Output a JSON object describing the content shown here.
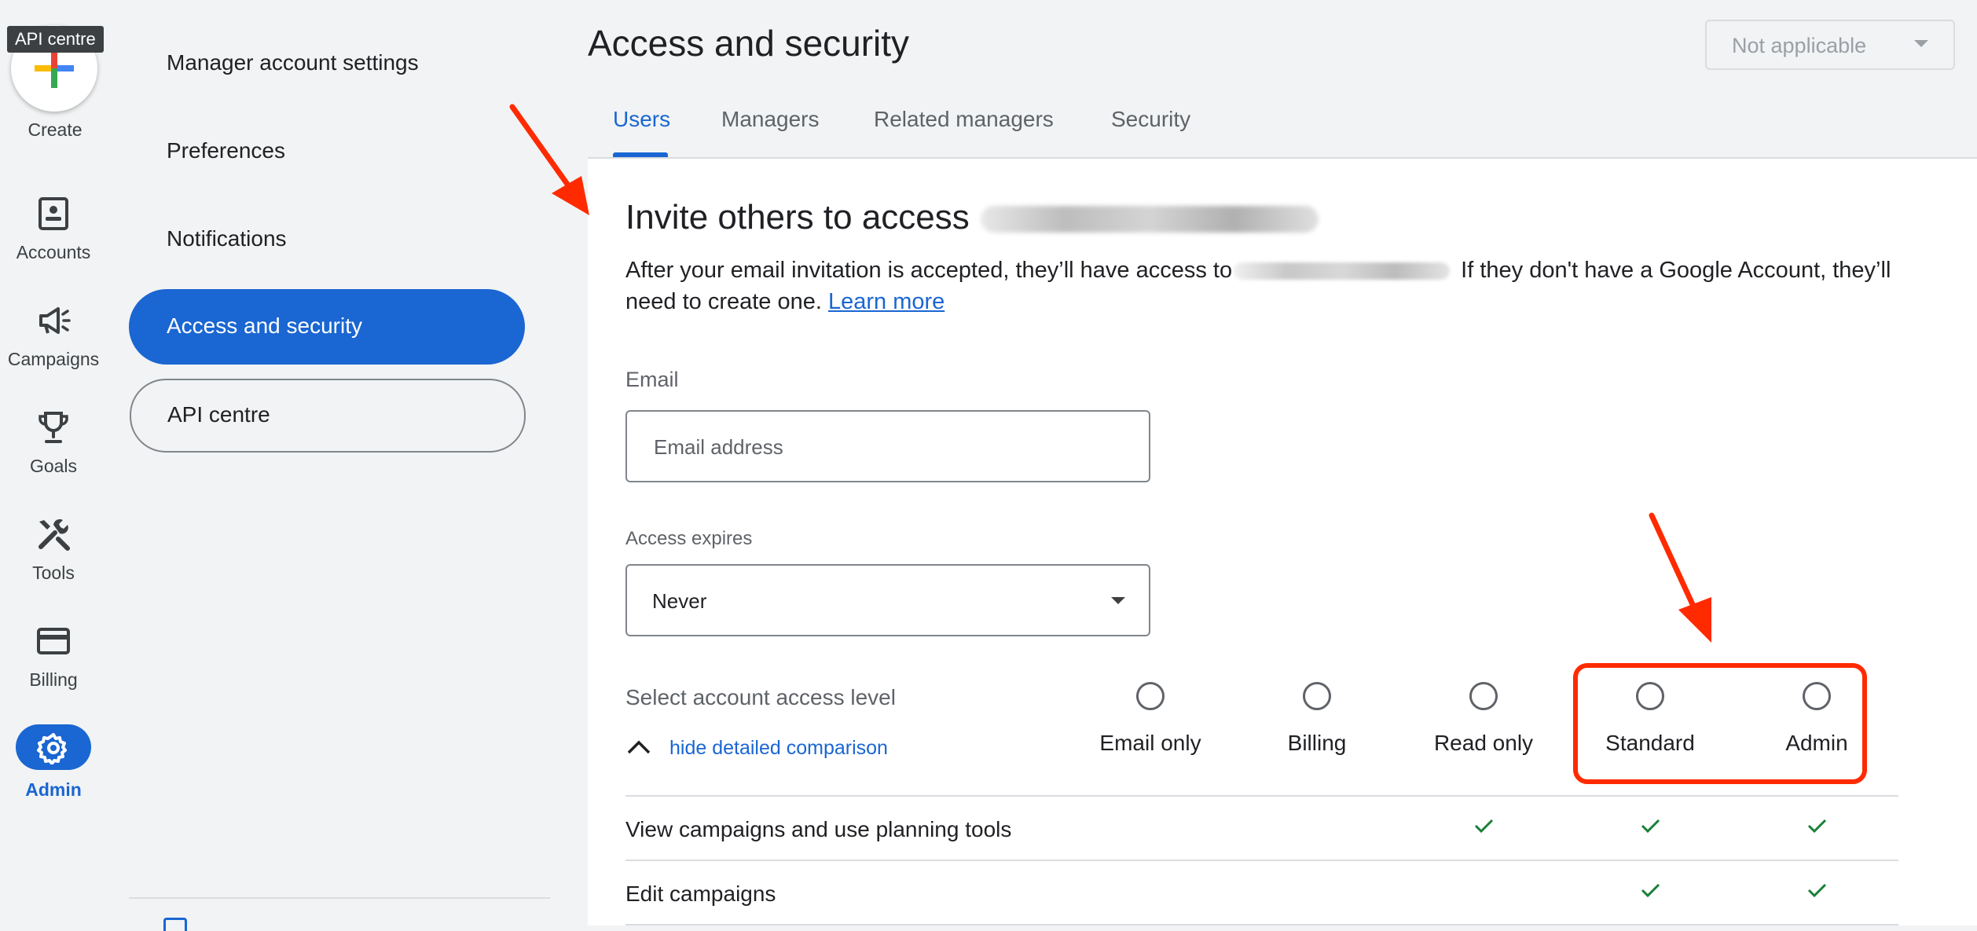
{
  "rail": {
    "tooltip": "API centre",
    "create_label": "Create",
    "items": [
      {
        "label": "Accounts",
        "icon": "accounts-icon"
      },
      {
        "label": "Campaigns",
        "icon": "campaigns-icon"
      },
      {
        "label": "Goals",
        "icon": "goals-icon"
      },
      {
        "label": "Tools",
        "icon": "tools-icon"
      },
      {
        "label": "Billing",
        "icon": "billing-icon"
      },
      {
        "label": "Admin",
        "icon": "admin-gear-icon",
        "active": true
      }
    ]
  },
  "settings_nav": {
    "items": [
      {
        "label": "Manager account settings"
      },
      {
        "label": "Preferences"
      },
      {
        "label": "Notifications"
      },
      {
        "label": "Access and security",
        "active": true
      },
      {
        "label": "API centre",
        "outlined": true
      }
    ]
  },
  "header": {
    "title": "Access and security",
    "account_select": "Not applicable",
    "tabs": [
      {
        "label": "Users",
        "active": true
      },
      {
        "label": "Managers"
      },
      {
        "label": "Related managers"
      },
      {
        "label": "Security"
      }
    ]
  },
  "invite": {
    "title": "Invite others to access",
    "desc_part1": "After your email invitation is accepted, they’ll have access to",
    "desc_part2": " If they don't have a Google Account, they’ll need to create one. ",
    "learn_more": "Learn more",
    "email_label": "Email",
    "email_placeholder": "Email address",
    "email_value": "",
    "expires_label": "Access expires",
    "expires_value": "Never",
    "level_label": "Select account access level",
    "hide_comparison": "hide detailed comparison",
    "levels": [
      {
        "label": "Email only",
        "selected": false
      },
      {
        "label": "Billing",
        "selected": false
      },
      {
        "label": "Read only",
        "selected": false
      },
      {
        "label": "Standard",
        "selected": false
      },
      {
        "label": "Admin",
        "selected": false
      }
    ],
    "comparison": [
      {
        "feature": "View campaigns and use planning tools",
        "levels": [
          "Read only",
          "Standard",
          "Admin"
        ]
      },
      {
        "feature": "Edit campaigns",
        "levels": [
          "Standard",
          "Admin"
        ]
      }
    ]
  },
  "colors": {
    "accent": "#1a66d2",
    "check": "#188038",
    "annotation": "#ff2a00",
    "background": "#f1f3f4"
  }
}
